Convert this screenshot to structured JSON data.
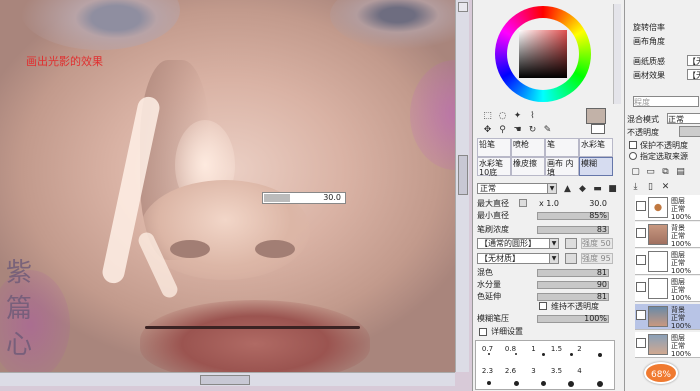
{
  "canvas": {
    "annotation": "画出光影的效果",
    "signature": "紫 篇 心",
    "brush_size_popup": "30.0"
  },
  "tool_panel": {
    "brush_tabs": [
      {
        "label": "铅笔"
      },
      {
        "label": "喷枪"
      },
      {
        "label": "笔"
      },
      {
        "label": "水彩笔"
      },
      {
        "label": "水彩笔 10底"
      },
      {
        "label": "橡皮擦"
      },
      {
        "label": "画布 内填"
      },
      {
        "label": "模糊",
        "selected": true
      }
    ],
    "blend_mode": "正常",
    "max_diameter_label": "最大直径",
    "max_diameter_mult": "x 1.0",
    "max_diameter_value": "30.0",
    "min_diameter_label": "最小直径",
    "min_diameter_value": "85%",
    "density_label": "笔刷浓度",
    "density_value": "83",
    "shape": "【通常的圆形】",
    "shape_strength_label": "强度",
    "shape_strength": "50",
    "texture": "【无材质】",
    "texture_strength_label": "强度",
    "texture_strength": "95",
    "mix_label": "混色",
    "mix_value": "81",
    "water_label": "水分量",
    "water_value": "90",
    "extend_label": "色延伸",
    "extend_value": "81",
    "keep_opacity_label": "维持不透明度",
    "pressure_label": "模糊笔压",
    "pressure_value": "100%",
    "detail_label": "详细设置",
    "dot_sizes_row1": [
      "0.7",
      "0.8",
      "1",
      "1.5",
      "2"
    ],
    "dot_sizes_row2": [
      "2.3",
      "2.6",
      "3",
      "3.5",
      "4"
    ]
  },
  "layer_panel": {
    "rotation_label": "旋转倍率",
    "angle_label": "画布角度",
    "paper_label": "画纸质感",
    "paper_value": "【无",
    "effect_label": "画材效果",
    "effect_value": "【无",
    "degree_label": "程度",
    "blend_label": "混合模式",
    "blend_value": "正常",
    "opacity_label": "不透明度",
    "protect_label": "保护不透明度",
    "select_source_label": "指定选取来源",
    "layers": [
      {
        "name": "图层",
        "mode": "正常",
        "opacity": "100%"
      },
      {
        "name": "背景",
        "mode": "正常",
        "opacity": "100%"
      },
      {
        "name": "图层",
        "mode": "正常",
        "opacity": "100%"
      },
      {
        "name": "图层",
        "mode": "正常",
        "opacity": "100%"
      },
      {
        "name": "背景",
        "mode": "正常",
        "opacity": "100%",
        "selected": true
      },
      {
        "name": "图层",
        "mode": "正常",
        "opacity": "100%"
      }
    ],
    "zoom": "68%"
  }
}
